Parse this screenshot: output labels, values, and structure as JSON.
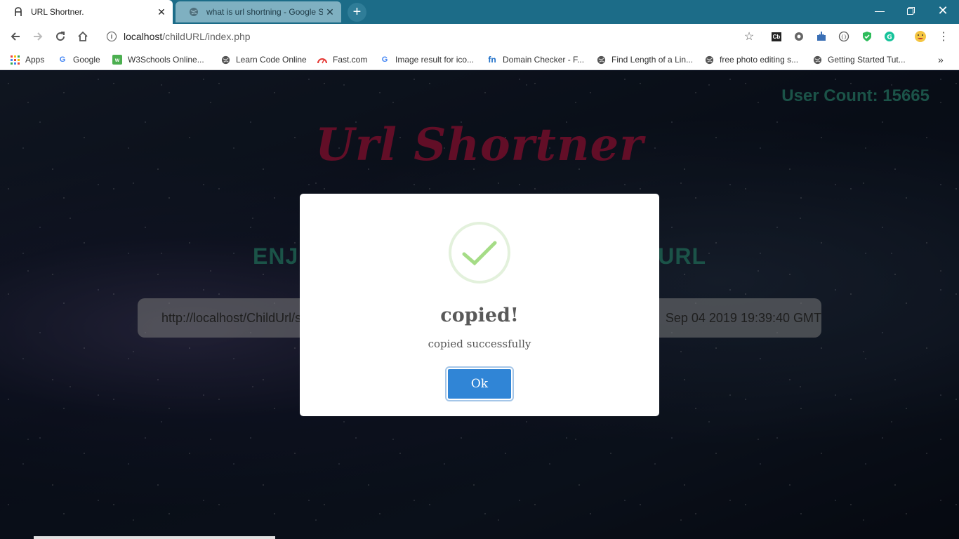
{
  "browser": {
    "tabs": [
      {
        "title": "URL Shortner.",
        "active": true
      },
      {
        "title": "what is url shortning - Google Se",
        "active": false
      }
    ],
    "address": {
      "host": "localhost",
      "path": "/childURL/index.php"
    },
    "bookmarks": [
      {
        "label": "Apps",
        "icon": "apps-grid-icon"
      },
      {
        "label": "Google",
        "icon": "google-icon"
      },
      {
        "label": "W3Schools Online...",
        "icon": "w3schools-icon"
      },
      {
        "label": "Learn Code Online",
        "icon": "globe-icon"
      },
      {
        "label": "Fast.com",
        "icon": "fast-icon"
      },
      {
        "label": "Image result for ico...",
        "icon": "google-icon"
      },
      {
        "label": "Domain Checker - F...",
        "icon": "fn-icon"
      },
      {
        "label": "Find Length of a Lin...",
        "icon": "globe-icon"
      },
      {
        "label": "free photo editing s...",
        "icon": "globe-icon"
      },
      {
        "label": "Getting Started Tut...",
        "icon": "globe-icon"
      }
    ],
    "more_bookmarks": "»",
    "colors": {
      "tabstrip": "#1c6c88"
    }
  },
  "page": {
    "user_count": "User Count: 15665",
    "title": "Url Shortner",
    "tagline_left": "ENJ",
    "tagline_right": "URL",
    "result_left": "http://localhost/ChildUrl/s",
    "result_right": "Sep 04 2019 19:39:40 GMT",
    "colors": {
      "title": "#a31842",
      "accent": "#2d8a78"
    }
  },
  "dialog": {
    "icon": "success-check-icon",
    "title": "copied!",
    "text": "copied successfully",
    "confirm_label": "Ok",
    "colors": {
      "confirm": "#3085d6",
      "check": "#a5dc86"
    }
  }
}
